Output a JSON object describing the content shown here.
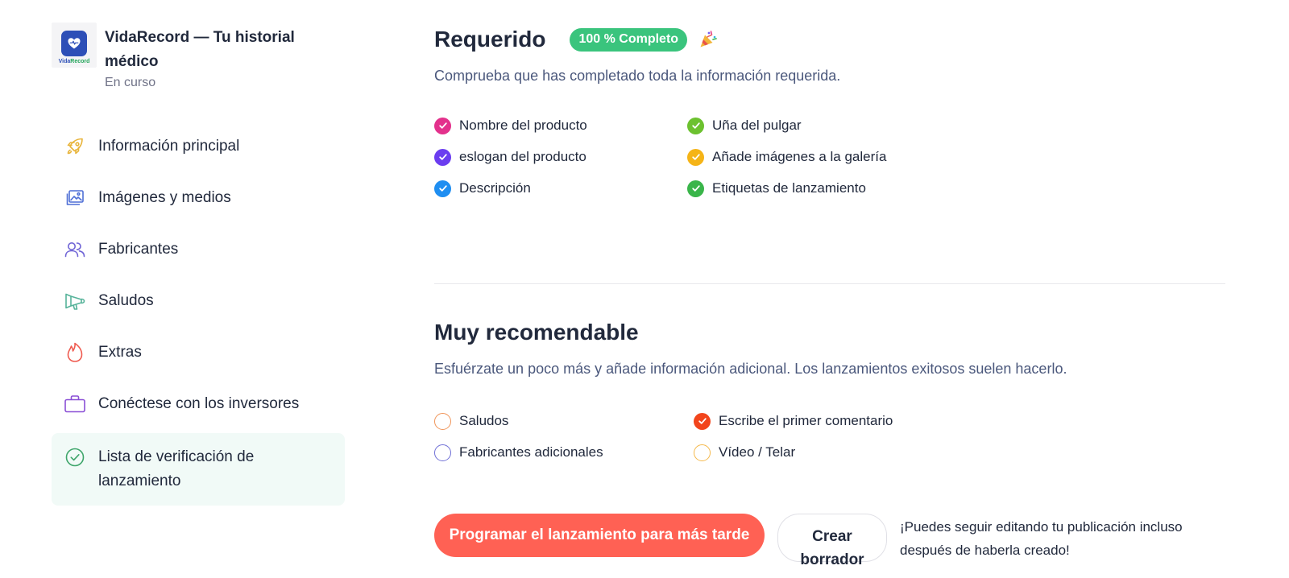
{
  "app": {
    "title": "VidaRecord — Tu historial médico",
    "status": "En curso",
    "logo_text_a": "Vida",
    "logo_text_b": "Record",
    "brand_color": "#2d4fb7"
  },
  "sidebar": {
    "items": [
      {
        "label": "Información principal",
        "icon": "rocket-icon",
        "color": "#e8b43a"
      },
      {
        "label": "Imágenes y medios",
        "icon": "images-icon",
        "color": "#4f6fd6"
      },
      {
        "label": "Fabricantes",
        "icon": "users-icon",
        "color": "#6f64d6"
      },
      {
        "label": "Saludos",
        "icon": "megaphone-icon",
        "color": "#56b39a"
      },
      {
        "label": "Extras",
        "icon": "flame-icon",
        "color": "#ef5a4f"
      },
      {
        "label": "Conéctese con los inversores",
        "icon": "briefcase-icon",
        "color": "#8a4fd6"
      },
      {
        "label": "Lista de verificación de lanzamiento",
        "icon": "check-circle-icon",
        "color": "#3ea56a",
        "active": true
      }
    ]
  },
  "required": {
    "title": "Requerido",
    "badge": "100 % Completo",
    "badge_color": "#3ac47d",
    "description": "Comprueba que has completado toda la información requerida.",
    "items": [
      {
        "label": "Nombre del producto",
        "checked": true,
        "color": "#e3318c"
      },
      {
        "label": "eslogan del producto",
        "checked": true,
        "color": "#6b3df0"
      },
      {
        "label": "Descripción",
        "checked": true,
        "color": "#1f8ef1"
      },
      {
        "label": "Uña del pulgar",
        "checked": true,
        "color": "#6cc12f"
      },
      {
        "label": "Añade imágenes a la galería",
        "checked": true,
        "color": "#f5b417"
      },
      {
        "label": "Etiquetas de lanzamiento",
        "checked": true,
        "color": "#3ab54a"
      }
    ]
  },
  "recommended": {
    "title": "Muy recomendable",
    "description": "Esfuérzate un poco más y añade información adicional. Los lanzamientos exitosos suelen hacerlo.",
    "items": [
      {
        "label": "Saludos",
        "checked": false,
        "color": "#f0955a"
      },
      {
        "label": "Fabricantes adicionales",
        "checked": false,
        "color": "#6f6fd6"
      },
      {
        "label": "Escribe el primer comentario",
        "checked": true,
        "color": "#f2451c"
      },
      {
        "label": "Vídeo / Telar",
        "checked": false,
        "color": "#f5b84a"
      }
    ]
  },
  "actions": {
    "schedule_label": "Programar el lanzamiento para más tarde",
    "draft_label": "Crear borrador",
    "note": "¡Puedes seguir editando tu publicación incluso después de haberla creado!",
    "primary_color": "#ff6154"
  }
}
